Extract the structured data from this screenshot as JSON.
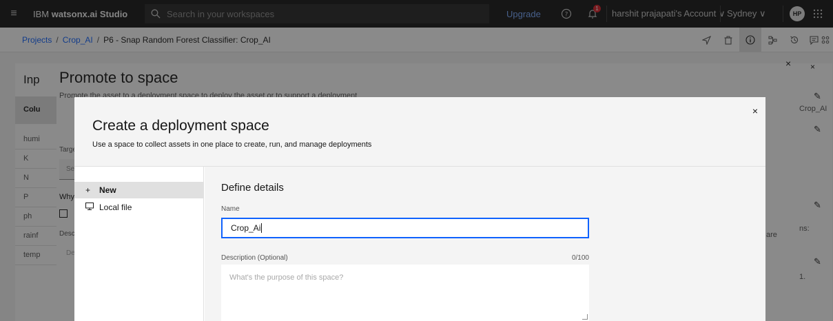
{
  "header": {
    "menu_icon": "hamburger-menu-icon",
    "brand_prefix": "IBM ",
    "brand_product": "watsonx.ai Studio",
    "search_placeholder": "Search in your workspaces",
    "upgrade_label": "Upgrade",
    "notification_count": "1",
    "account_label": "harshit prajapati's Account ∨",
    "region_label": "Sydney ∨",
    "avatar_initials": "HP"
  },
  "breadcrumb": {
    "projects": "Projects",
    "project": "Crop_AI",
    "current": "P6 - Snap Random Forest Classifier: Crop_AI",
    "separator": "/"
  },
  "background": {
    "tab_label": "Inp",
    "column_header": "Colu",
    "rows": [
      "humi",
      "K",
      "N",
      "P",
      "ph",
      "rainf",
      "temp"
    ],
    "promote_title": "Promote to space",
    "promote_subtitle": "Promote the asset to a deployment space to deploy the asset or to support a deployment",
    "target_label": "Targe",
    "target_value": "Se",
    "why_label": "Why",
    "desc_label": "Descr",
    "desc_value": "De",
    "right_name": "Crop_AI",
    "right_suffix": "ns:",
    "right_are": "are",
    "right_dot": "1."
  },
  "modal": {
    "title": "Create a deployment space",
    "subtitle": "Use a space to collect assets in one place to create, run, and manage deployments",
    "close_label": "×",
    "side_items": [
      {
        "icon": "+",
        "label": "New"
      },
      {
        "icon": "▭",
        "label": "Local file"
      }
    ],
    "section_title": "Define details",
    "name_label": "Name",
    "name_value": "Crop_Ai",
    "description_label": "Description (Optional)",
    "description_counter": "0/100",
    "description_placeholder": "What's the purpose of this space?"
  },
  "colors": {
    "header_bg": "#161616",
    "accent": "#0f62fe",
    "notification": "#da1e28"
  }
}
